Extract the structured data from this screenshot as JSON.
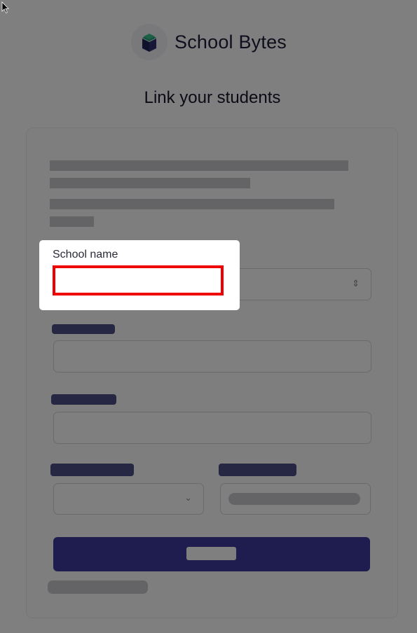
{
  "header": {
    "brand_name": "School Bytes",
    "logo_icon": "book-logo-icon"
  },
  "page": {
    "title": "Link your students"
  },
  "form": {
    "school_name_label": "School name",
    "school_name_value": ""
  },
  "colors": {
    "brand_navy": "#1c1d3b",
    "accent_indigo": "#3e3b9e",
    "highlight_red": "#ee0000",
    "overlay": "rgba(0,0,0,0.5)"
  }
}
